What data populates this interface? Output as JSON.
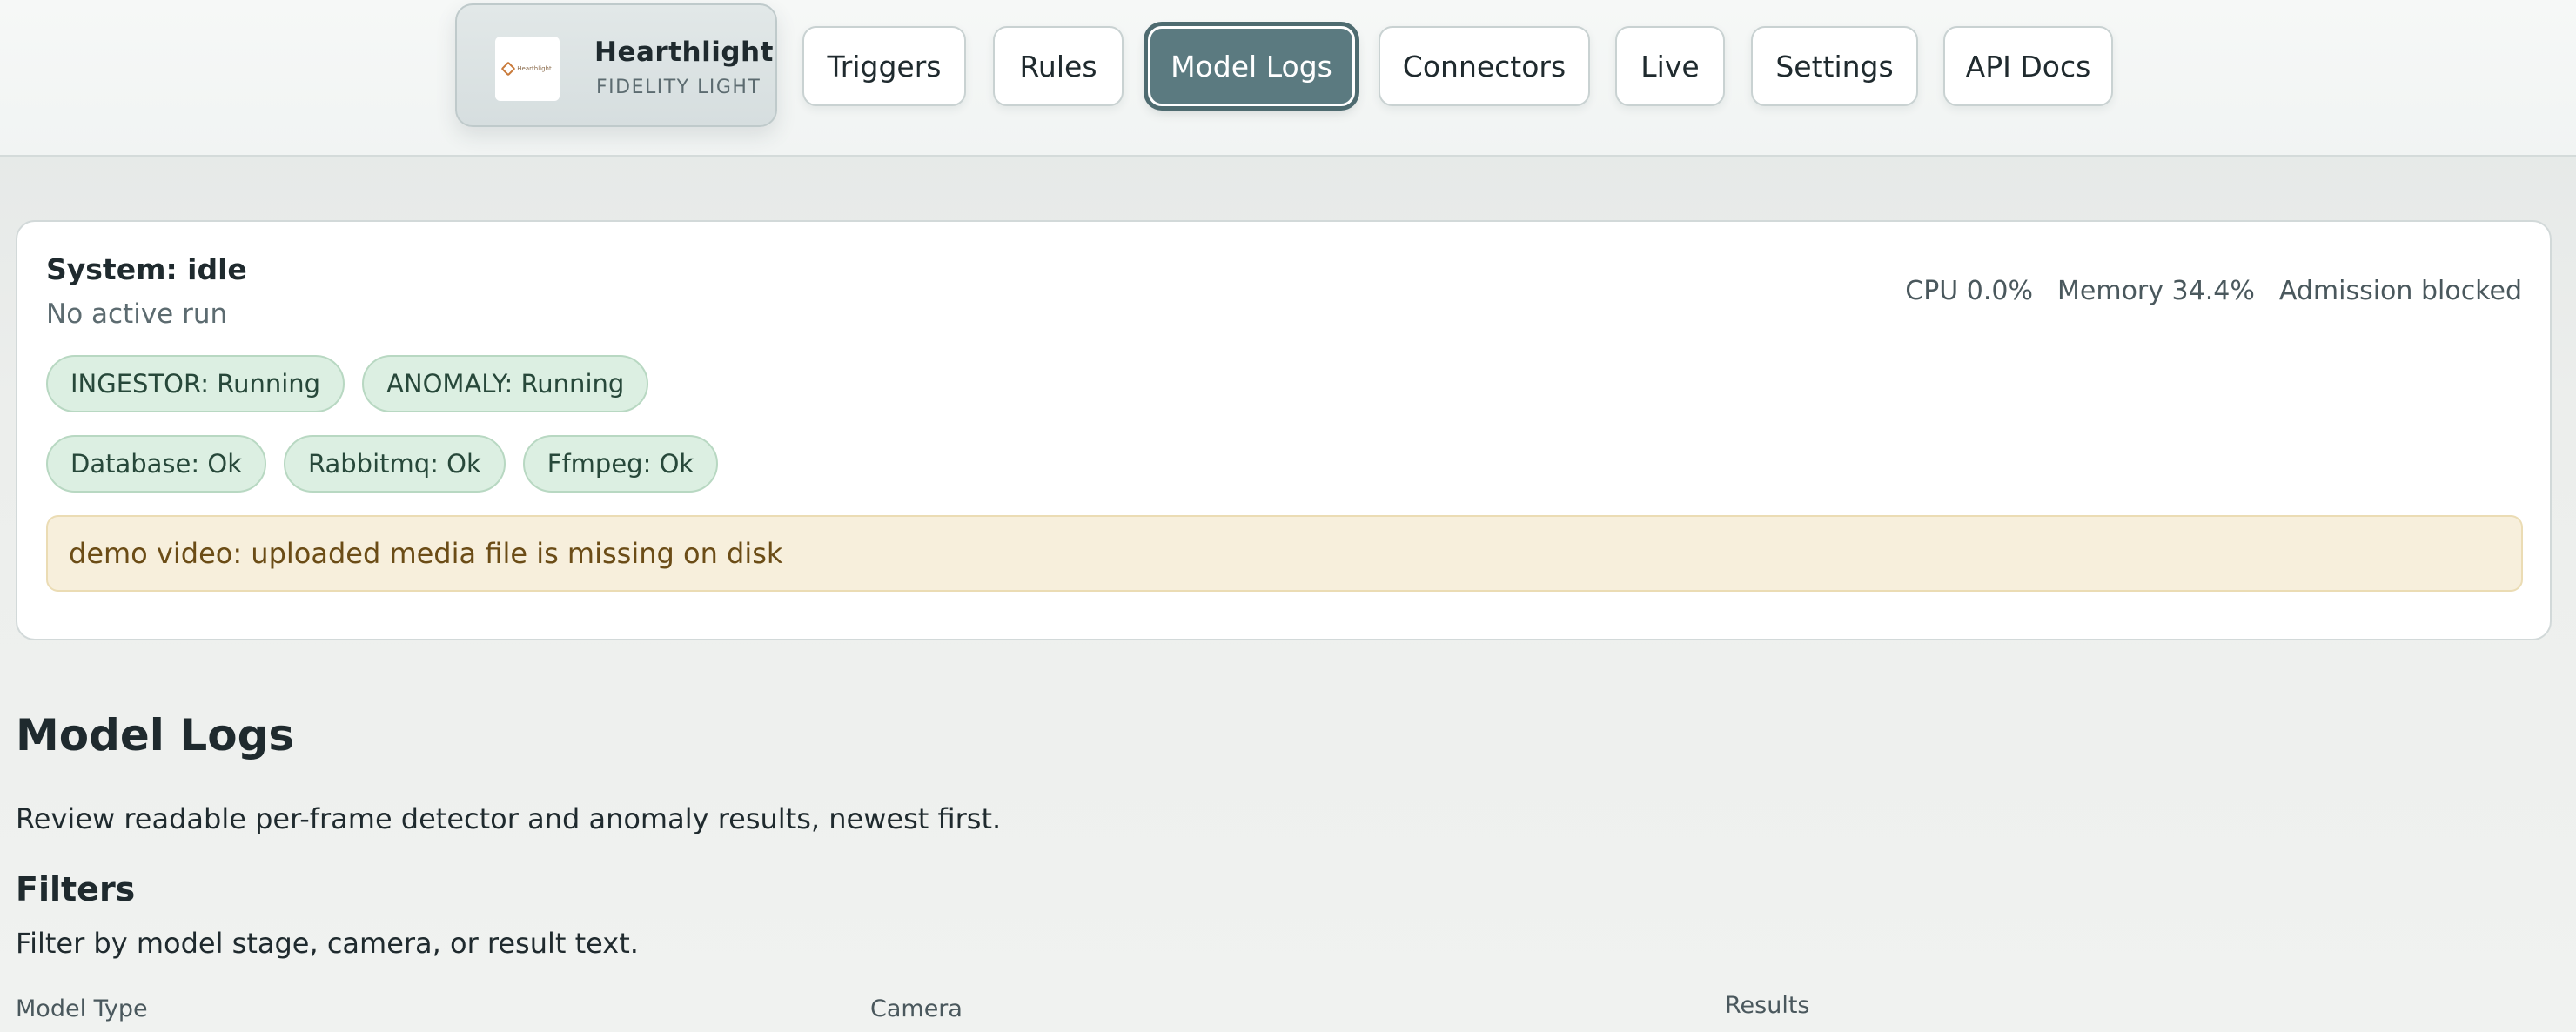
{
  "brand": {
    "title": "Hearthlight",
    "subtitle": "FIDELITY LIGHT",
    "logo_text": "Hearthlight"
  },
  "nav": {
    "items": [
      {
        "label": "Triggers"
      },
      {
        "label": "Rules"
      },
      {
        "label": "Model Logs",
        "active": true
      },
      {
        "label": "Connectors"
      },
      {
        "label": "Live"
      },
      {
        "label": "Settings"
      },
      {
        "label": "API Docs"
      }
    ]
  },
  "status": {
    "title": "System: idle",
    "subtitle": "No active run",
    "metrics": {
      "cpu": "CPU 0.0%",
      "memory": "Memory 34.4%",
      "admission": "Admission blocked"
    },
    "services": [
      {
        "label": "INGESTOR: Running"
      },
      {
        "label": "ANOMALY: Running"
      }
    ],
    "dependencies": [
      {
        "label": "Database: Ok"
      },
      {
        "label": "Rabbitmq: Ok"
      },
      {
        "label": "Ffmpeg: Ok"
      }
    ],
    "alert": "demo video: uploaded media file is missing on disk"
  },
  "main": {
    "title": "Model Logs",
    "description": "Review readable per-frame detector and anomaly results, newest first.",
    "filters": {
      "title": "Filters",
      "description": "Filter by model stage, camera, or result text.",
      "fields": [
        {
          "label": "Model Type"
        },
        {
          "label": "Camera"
        },
        {
          "label": "Results"
        }
      ]
    }
  },
  "colors": {
    "accent": "#5b7a80",
    "ok_pill": "#dcefe2",
    "alert_bg": "#f7efdc",
    "alert_text": "#6b4c16"
  }
}
